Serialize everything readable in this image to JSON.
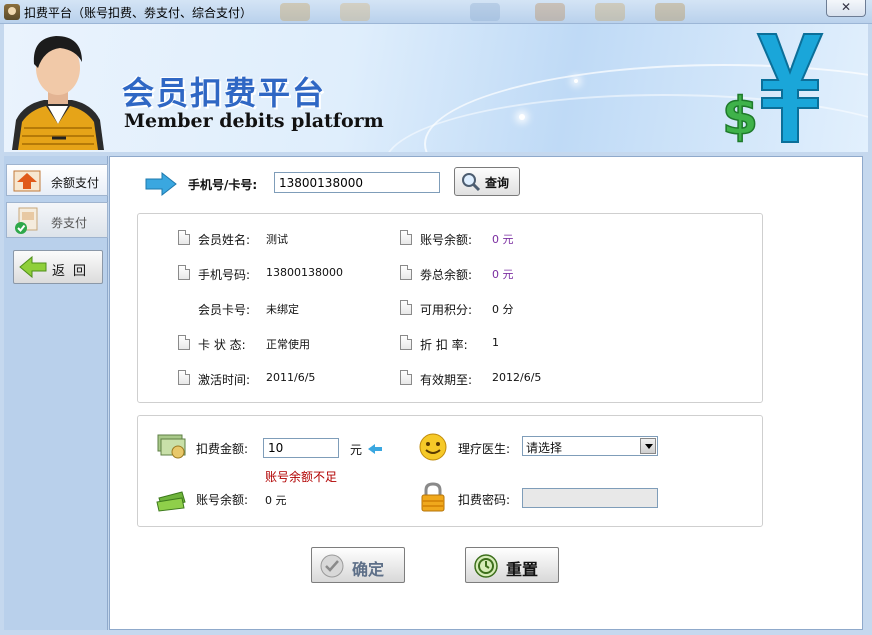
{
  "window": {
    "title": "扣费平台（账号扣费、劵支付、综合支付）",
    "close_glyph": "✕"
  },
  "banner": {
    "title_cn": "会员扣费平台",
    "title_en": "Member debits platform"
  },
  "sidebar": {
    "items": [
      {
        "label": "余额支付"
      },
      {
        "label": "劵支付"
      }
    ],
    "back_label": "返回"
  },
  "search": {
    "label": "手机号/卡号:",
    "value": "13800138000",
    "button_label": "查询"
  },
  "member": {
    "name_label": "会员姓名:",
    "name_value": "测试",
    "phone_label": "手机号码:",
    "phone_value": "13800138000",
    "card_label": "会员卡号:",
    "card_value": "未绑定",
    "status_label": "卡 状 态:",
    "status_value": "正常使用",
    "activate_label": "激活时间:",
    "activate_value": "2011/6/5",
    "balance_label": "账号余额:",
    "balance_value": "0 元",
    "coupon_label": "劵总余额:",
    "coupon_value": "0 元",
    "points_label": "可用积分:",
    "points_value": "0 分",
    "discount_label": "折 扣 率:",
    "discount_value": "1",
    "expire_label": "有效期至:",
    "expire_value": "2012/6/5"
  },
  "payment": {
    "amount_label": "扣费金额:",
    "amount_value": "10",
    "amount_unit": "元",
    "warning": "账号余额不足",
    "balance_label": "账号余额:",
    "balance_value": "0 元",
    "doctor_label": "理疗医生:",
    "doctor_value": "请选择",
    "password_label": "扣费密码:",
    "password_value": ""
  },
  "actions": {
    "confirm_label": "确定",
    "reset_label": "重置"
  },
  "colors": {
    "accent_blue": "#2f67c4",
    "warning_red": "#b10000",
    "value_purple": "#7a2da0"
  }
}
